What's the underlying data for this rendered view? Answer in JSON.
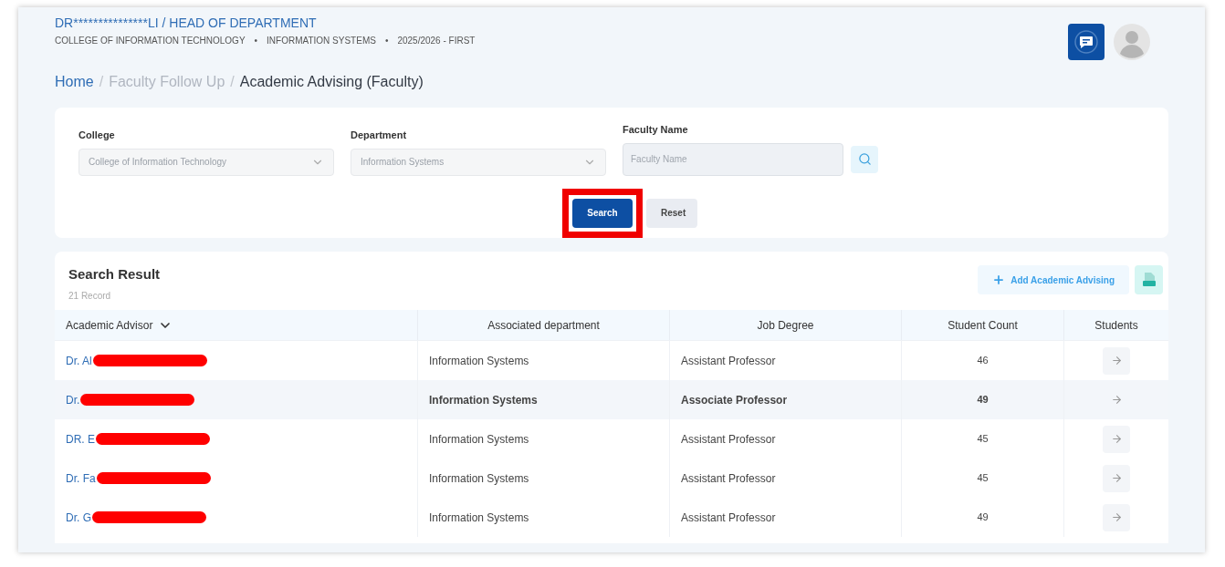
{
  "header": {
    "user": "DR***************LI / HEAD OF DEPARTMENT",
    "context": [
      "COLLEGE OF INFORMATION TECHNOLOGY",
      "INFORMATION SYSTEMS",
      "2025/2026 - FIRST"
    ],
    "separator": "•"
  },
  "breadcrumb_separator": "/",
  "breadcrumb": [
    {
      "label": "Home",
      "kind": "link"
    },
    {
      "label": "Faculty Follow Up",
      "kind": "muted"
    },
    {
      "label": "Academic Advising (Faculty)",
      "kind": "current"
    }
  ],
  "filters": [
    {
      "label": "College",
      "kind": "select",
      "value": "College of Information Technology",
      "disabled": true
    },
    {
      "label": "Department",
      "kind": "select",
      "value": "Information Systems",
      "disabled": true
    },
    {
      "label": "Faculty Name",
      "kind": "text",
      "placeholder": "Faculty Name"
    }
  ],
  "buttons": [
    {
      "label": "Search",
      "kind": "primary",
      "highlighted": true
    },
    {
      "label": "Reset",
      "kind": "secondary",
      "highlighted": false
    }
  ],
  "results": {
    "title": "Search Result",
    "count": "21 Record",
    "add_button": "Add Academic Advising",
    "columns": [
      "Academic Advisor",
      "Associated department",
      "Job Degree",
      "Student Count",
      "Students"
    ],
    "rows": [
      {
        "advisor": "Dr. Al",
        "redacted": true,
        "department": "Information Systems",
        "degree": "Assistant Professor",
        "count": "46",
        "hovered": false
      },
      {
        "advisor": "Dr.",
        "redacted": true,
        "department": "Information Systems",
        "degree": "Associate Professor",
        "count": "49",
        "hovered": true
      },
      {
        "advisor": "DR. E",
        "redacted": true,
        "department": "Information Systems",
        "degree": "Assistant Professor",
        "count": "45",
        "hovered": false
      },
      {
        "advisor": "Dr. Fa",
        "redacted": true,
        "department": "Information Systems",
        "degree": "Assistant Professor",
        "count": "45",
        "hovered": false
      },
      {
        "advisor": "Dr. G",
        "redacted": true,
        "department": "Information Systems",
        "degree": "Assistant Professor",
        "count": "49",
        "hovered": false
      }
    ]
  }
}
